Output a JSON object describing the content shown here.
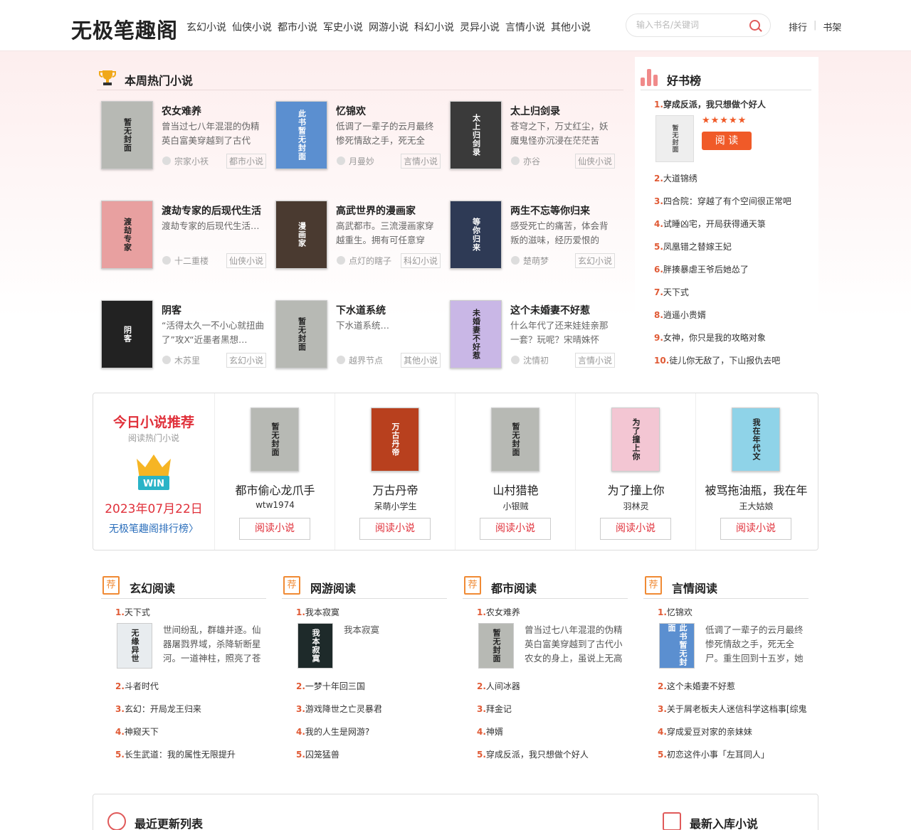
{
  "header": {
    "logo": "无极笔趣阁",
    "nav": [
      "玄幻小说",
      "仙侠小说",
      "都市小说",
      "军史小说",
      "网游小说",
      "科幻小说",
      "灵异小说",
      "言情小说",
      "其他小说"
    ],
    "search_placeholder": "输入书名/关键词",
    "rank_link": "排行",
    "sep": "|",
    "shelf_link": "书架"
  },
  "hot": {
    "title": "本周热门小说",
    "books": [
      {
        "name": "农女难养",
        "desc": "曾当过七八年混混的伪精英白富美穿越到了古代小…",
        "author": "宗家小祆",
        "tag": "都市小说",
        "cover": "暂无封面",
        "color": "#b7b9b4"
      },
      {
        "name": "忆锦欢",
        "desc": "低调了一辈子的云月最终惨死情敌之手，死无全尸…",
        "author": "月曼妙",
        "tag": "言情小说",
        "cover": "此书暂无封面",
        "color": "#5b8fd0"
      },
      {
        "name": "太上归剑录",
        "desc": "苍穹之下，万丈红尘，妖魔鬼怪亦沉浸在茫茫苦海…",
        "author": "亦谷",
        "tag": "仙侠小说",
        "cover": "太上归剑录",
        "color": "#3a3a3a"
      },
      {
        "name": "渡劫专家的后现代生活",
        "desc": "渡劫专家的后现代生活…",
        "author": "十二重楼",
        "tag": "仙侠小说",
        "cover": "渡劫专家",
        "color": "#e8a0a0"
      },
      {
        "name": "高武世界的漫画家",
        "desc": "高武都市。三流漫画家穿越重生。拥有可任意穿梭…",
        "author": "点灯的瞎子",
        "tag": "科幻小说",
        "cover": "漫画家",
        "color": "#4a3a30"
      },
      {
        "name": "两生不忘等你归来",
        "desc": "感受死亡的痛苦，体会背叛的滋味，经历爱恨的折…",
        "author": "楚萌梦",
        "tag": "玄幻小说",
        "cover": "等你归来",
        "color": "#2e3a55"
      },
      {
        "name": "阴客",
        "desc": "“活得太久一不小心就扭曲了”攻X“近墨者黑想…",
        "author": "木苏里",
        "tag": "玄幻小说",
        "cover": "阴客",
        "color": "#222"
      },
      {
        "name": "下水道系统",
        "desc": "下水道系统…",
        "author": "越界节点",
        "tag": "其他小说",
        "cover": "暂无封面",
        "color": "#b7b9b4"
      },
      {
        "name": "这个未婚妻不好惹",
        "desc": "什么年代了还来娃娃亲那一套？玩呢？宋晴姝怀着…",
        "author": "沈情初",
        "tag": "言情小说",
        "cover": "未婚妻不好惹",
        "color": "#c9b7e6"
      }
    ]
  },
  "ranking": {
    "title": "好书榜",
    "stars": "★★★★★",
    "read_btn": "阅 读",
    "top_cover": "暂无封面",
    "items": [
      {
        "num": "1.",
        "name": "穿成反派，我只想做个好人"
      },
      {
        "num": "2.",
        "name": "大道锦绣"
      },
      {
        "num": "3.",
        "name": "四合院：穿越了有个空间很正常吧"
      },
      {
        "num": "4.",
        "name": "试睡凶宅，开局获得通天箓"
      },
      {
        "num": "5.",
        "name": "凤凰错之替嫁王妃"
      },
      {
        "num": "6.",
        "name": "胖揍暴虐王爷后她怂了"
      },
      {
        "num": "7.",
        "name": "天下式"
      },
      {
        "num": "8.",
        "name": "逍遥小贵婿"
      },
      {
        "num": "9.",
        "name": "女神，你只是我的攻略对象"
      },
      {
        "num": "10.",
        "name": "徒儿你无敌了，下山报仇去吧"
      }
    ]
  },
  "today": {
    "title": "今日小说推荐",
    "subtitle": "阅读热门小说",
    "badge": "WIN",
    "date": "2023年07月22日",
    "link": "无极笔趣阁排行榜〉",
    "read_label": "阅读小说",
    "books": [
      {
        "name": "都市偷心龙爪手",
        "author": "wtw1974",
        "cover": "暂无封面",
        "color": "#b7b9b4"
      },
      {
        "name": "万古丹帝",
        "author": "呆萌小学生",
        "cover": "万古丹帝",
        "color": "#b8401e"
      },
      {
        "name": "山村猎艳",
        "author": "小银贼",
        "cover": "暂无封面",
        "color": "#b7b9b4"
      },
      {
        "name": "为了撞上你",
        "author": "羽林灵",
        "cover": "为了撞上你",
        "color": "#f3c6d3"
      },
      {
        "name": "被骂拖油瓶，我在年",
        "author": "王大姑娘",
        "cover": "我在年代文",
        "color": "#8fd3e8"
      }
    ]
  },
  "categories": [
    {
      "badge": "荐",
      "title": "玄幻阅读",
      "first": {
        "num": "1.",
        "name": "天下式",
        "desc": "世间纷乱，群雄并逐。仙器屠戮界域，杀降斩断星河。一道神柱，照亮了苍穹，亦",
        "cover": "无缘异世",
        "color": "#e8ecef"
      },
      "list": [
        {
          "num": "2.",
          "name": "斗者时代"
        },
        {
          "num": "3.",
          "name": "玄幻：开局龙王归来"
        },
        {
          "num": "4.",
          "name": "神窥天下"
        },
        {
          "num": "5.",
          "name": "长生武道：我的属性无限提升"
        }
      ]
    },
    {
      "badge": "荐",
      "title": "网游阅读",
      "first": {
        "num": "1.",
        "name": "我本寂寞",
        "desc": "我本寂寞",
        "cover": "我本寂寞",
        "color": "#1e2a2a"
      },
      "list": [
        {
          "num": "2.",
          "name": "一梦十年回三国"
        },
        {
          "num": "3.",
          "name": "游戏降世之亡灵暴君"
        },
        {
          "num": "4.",
          "name": "我的人生是网游?"
        },
        {
          "num": "5.",
          "name": "囚笼猛兽"
        }
      ]
    },
    {
      "badge": "荐",
      "title": "都市阅读",
      "first": {
        "num": "1.",
        "name": "农女难养",
        "desc": "曾当过七八年混混的伪精英白富美穿越到了古代小农女的身上，虽说上无高堂，可",
        "cover": "暂无封面",
        "color": "#b7b9b4"
      },
      "list": [
        {
          "num": "2.",
          "name": "人间冰器"
        },
        {
          "num": "3.",
          "name": "拜金记"
        },
        {
          "num": "4.",
          "name": "神婿"
        },
        {
          "num": "5.",
          "name": "穿成反派，我只想做个好人"
        }
      ]
    },
    {
      "badge": "荐",
      "title": "言情阅读",
      "first": {
        "num": "1.",
        "name": "忆锦欢",
        "desc": "低调了一辈子的云月最终惨死情敌之手，死无全尸。重生回到十五岁，她决定不再",
        "cover": "此书暂无封面",
        "color": "#5b8fd0"
      },
      "list": [
        {
          "num": "2.",
          "name": "这个未婚妻不好惹"
        },
        {
          "num": "3.",
          "name": "关于屑老板夫人迷信科学这档事[综鬼"
        },
        {
          "num": "4.",
          "name": "穿成爱豆对家的亲妹妹"
        },
        {
          "num": "5.",
          "name": "初恋这件小事「左耳同人」"
        }
      ]
    }
  ],
  "bottom": {
    "recent": "最近更新列表",
    "newest": "最新入库小说"
  }
}
